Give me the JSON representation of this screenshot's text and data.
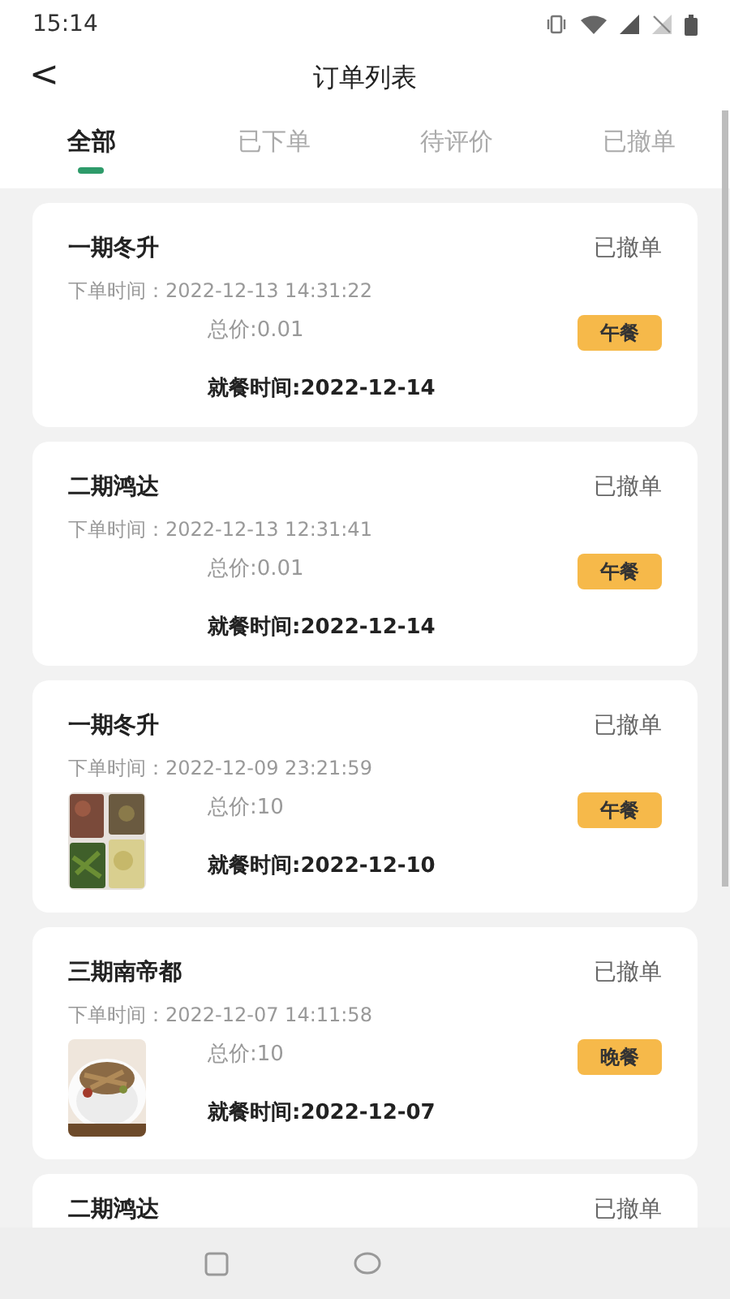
{
  "status_bar": {
    "time": "15:14"
  },
  "header": {
    "back": "<",
    "title": "订单列表"
  },
  "tabs": [
    {
      "label": "全部",
      "selected": true
    },
    {
      "label": "已下单",
      "selected": false
    },
    {
      "label": "待评价",
      "selected": false
    },
    {
      "label": "已撤单",
      "selected": false
    }
  ],
  "orders": [
    {
      "title": "一期冬升",
      "status": "已撤单",
      "order_time": "下单时间：2022-12-13 14:31:22",
      "total": "总价:0.01",
      "meal": "午餐",
      "dining_time": "就餐时间:2022-12-14"
    },
    {
      "title": "二期鸿达",
      "status": "已撤单",
      "order_time": "下单时间：2022-12-13 12:31:41",
      "total": "总价:0.01",
      "meal": "午餐",
      "dining_time": "就餐时间:2022-12-14"
    },
    {
      "title": "一期冬升",
      "status": "已撤单",
      "order_time": "下单时间：2022-12-09 23:21:59",
      "total": "总价:10",
      "meal": "午餐",
      "dining_time": "就餐时间:2022-12-10"
    },
    {
      "title": "三期南帝都",
      "status": "已撤单",
      "order_time": "下单时间：2022-12-07 14:11:58",
      "total": "总价:10",
      "meal": "晚餐",
      "dining_time": "就餐时间:2022-12-07"
    },
    {
      "title": "二期鸿达",
      "status": "已撤单"
    }
  ]
}
